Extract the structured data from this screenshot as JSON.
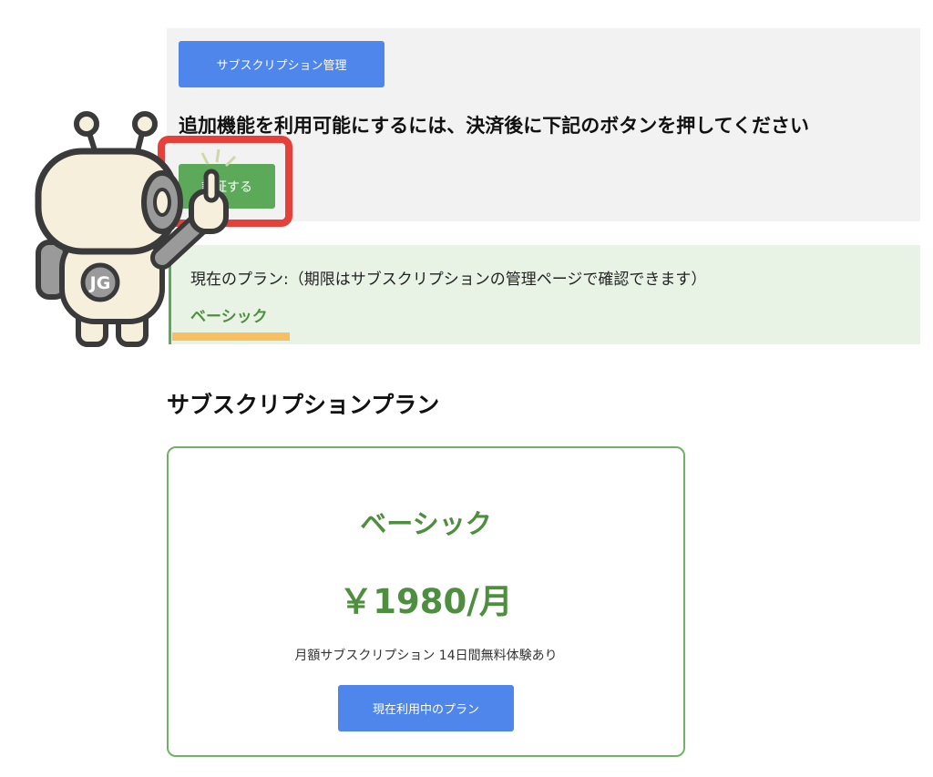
{
  "header": {
    "manage_button_label": "サブスクリプション管理",
    "instruction_text": "追加機能を利用可能にするには、決済後に下記のボタンを押してください",
    "auth_button_label": "認証する"
  },
  "current_plan": {
    "label": "現在のプラン:（期限はサブスクリプションの管理ページで確認できます）",
    "name": "ベーシック"
  },
  "plans_section": {
    "title": "サブスクリプションプラン",
    "cards": [
      {
        "name": "ベーシック",
        "price": "￥1980/月",
        "description": "月額サブスクリプション 14日間無料体験あり",
        "button_label": "現在利用中のプラン"
      }
    ]
  },
  "mascot": {
    "badge_text": "JG",
    "icon": "robot-mascot-icon"
  },
  "colors": {
    "primary_blue": "#4f86ec",
    "success_green": "#5ca95a",
    "text_green": "#4e8f3f",
    "highlight_red": "#e5403a",
    "highlight_yellow": "#f6bf62",
    "light_green_bg": "#e8f3e6",
    "gray_bg": "#f2f2f2"
  }
}
